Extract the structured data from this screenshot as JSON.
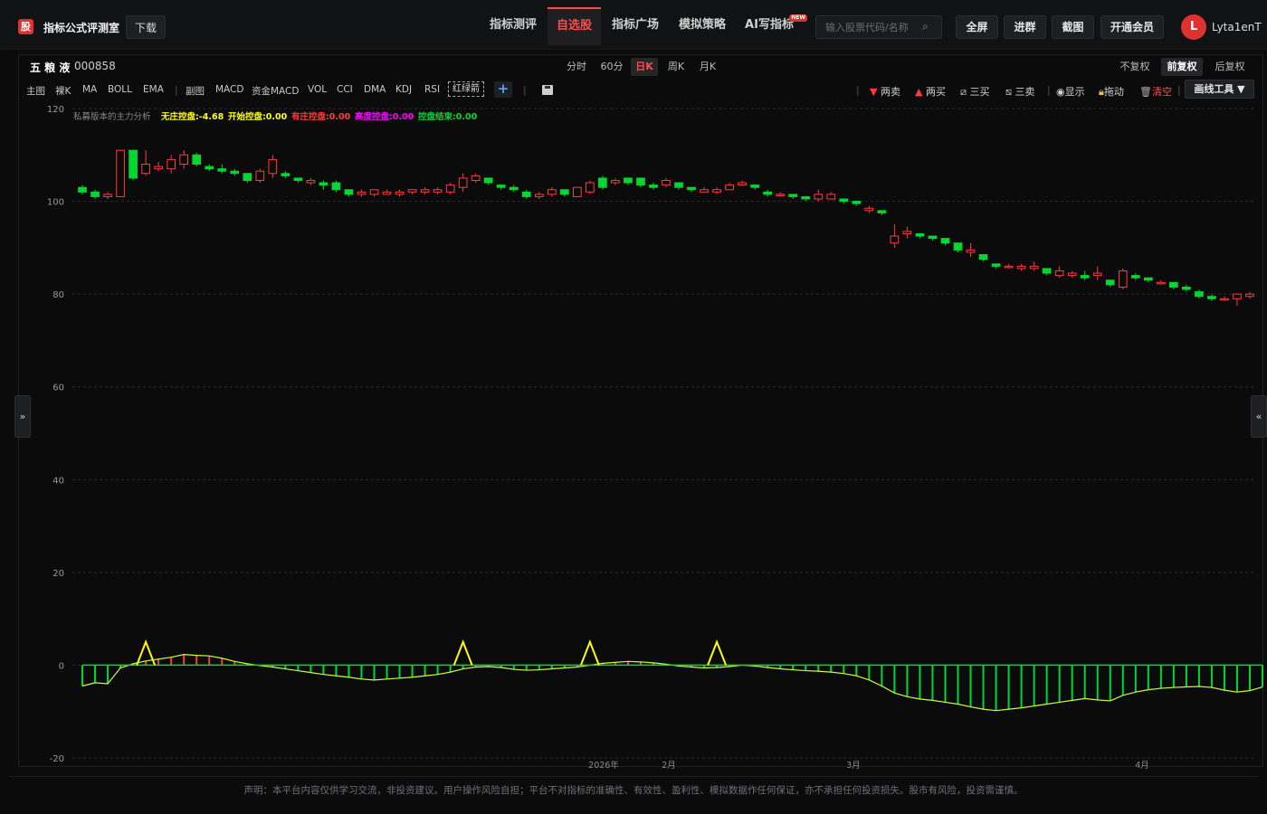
{
  "header": {
    "logo_char": "股",
    "title": "指标公式评测室",
    "download": "下载",
    "nav": [
      "指标测评",
      "自选股",
      "指标广场",
      "模拟策略",
      "AI写指标"
    ],
    "nav_active": 1,
    "new_badge": "NEW",
    "search_placeholder": "输入股票代码/名称",
    "buttons": [
      "全屏",
      "进群",
      "截图",
      "开通会员"
    ],
    "avatar_letter": "L",
    "username": "Lyta1enT"
  },
  "stock": {
    "name": "五 粮 液",
    "code": "000858"
  },
  "periods": [
    "分时",
    "60分",
    "日K",
    "周K",
    "月K"
  ],
  "period_active": 2,
  "fuquan": [
    "不复权",
    "前复权",
    "后复权"
  ],
  "fuquan_active": 1,
  "indicators_main": [
    "主图",
    "裸K",
    "MA",
    "BOLL",
    "EMA"
  ],
  "indicators_sub": [
    "副图",
    "MACD",
    "资金MACD",
    "VOL",
    "CCI",
    "DMA",
    "KDJ",
    "RSI"
  ],
  "indicator_boxed": "红绿箭",
  "tools": {
    "two_sell": "两卖",
    "two_buy": "两买",
    "three_buy": "三买",
    "three_sell": "三卖",
    "show": "显示",
    "drag": "拖动",
    "clear": "清空",
    "draw": "画线工具 ▼"
  },
  "colors": {
    "up": "#ff3b3b",
    "down": "#00d730",
    "accent": "#ff4b4b",
    "signal": "#ffff00",
    "magenta": "#ff00ff"
  },
  "legend": [
    {
      "label": "私募版本的主力分析",
      "color": "#888888"
    },
    {
      "label": "无庄控盘:-4.68",
      "color": "#ffff00"
    },
    {
      "label": "开始控盘:0.00",
      "color": "#ffff00"
    },
    {
      "label": "有庄控盘:0.00",
      "color": "#ff3b3b"
    },
    {
      "label": "高度控盘:0.00",
      "color": "#ff00ff"
    },
    {
      "label": "控盘结束:0.00",
      "color": "#00d730"
    }
  ],
  "chart_data": {
    "type": "candlestick",
    "y_ticks": [
      120,
      100,
      80,
      60,
      40,
      20,
      0,
      -20
    ],
    "ylim": [
      -20,
      120
    ],
    "x_labels": [
      "2026年",
      "2月",
      "3月",
      "4月"
    ],
    "grid": true,
    "candles": [
      [
        103,
        102,
        103.5,
        101.5
      ],
      [
        102,
        101,
        102.5,
        100.5
      ],
      [
        101,
        101.5,
        102,
        100.5
      ],
      [
        101,
        111,
        111,
        101
      ],
      [
        111,
        105,
        111,
        104.5
      ],
      [
        106,
        108,
        111,
        105.5
      ],
      [
        107,
        107.5,
        108.5,
        106.5
      ],
      [
        107,
        109,
        110,
        106
      ],
      [
        108,
        110,
        111,
        107
      ],
      [
        110,
        108,
        110.5,
        107.5
      ],
      [
        107.5,
        107,
        108,
        106.5
      ],
      [
        107,
        106.5,
        108,
        106
      ],
      [
        106.5,
        106,
        107,
        105.5
      ],
      [
        106,
        104.5,
        106,
        104
      ],
      [
        104.5,
        106.5,
        107,
        104
      ],
      [
        106,
        109,
        110,
        105
      ],
      [
        106,
        105.5,
        106.5,
        105
      ],
      [
        105,
        104.5,
        105,
        104
      ],
      [
        104,
        104.5,
        105,
        103.5
      ],
      [
        104,
        103.5,
        104.5,
        102.5
      ],
      [
        104,
        102.5,
        104.5,
        102
      ],
      [
        102.5,
        101.5,
        102.5,
        101
      ],
      [
        101.5,
        102,
        102.5,
        101
      ],
      [
        101.5,
        102.5,
        102.5,
        101
      ],
      [
        101.5,
        102,
        102.5,
        101.5
      ],
      [
        101.5,
        102,
        102.5,
        101
      ],
      [
        102,
        102.5,
        102.5,
        101.5
      ],
      [
        102,
        102.5,
        103,
        101.5
      ],
      [
        102,
        102.5,
        103,
        101.5
      ],
      [
        102,
        103.5,
        104,
        101.5
      ],
      [
        103,
        105,
        106,
        102
      ],
      [
        104.5,
        105.5,
        106,
        104
      ],
      [
        105,
        104,
        105,
        103.5
      ],
      [
        103.5,
        103,
        103.5,
        102.5
      ],
      [
        103,
        102.5,
        103.5,
        102
      ],
      [
        102,
        101,
        102.5,
        100.5
      ],
      [
        101,
        101.5,
        102,
        100.5
      ],
      [
        101.5,
        102.5,
        103,
        101
      ],
      [
        102.5,
        101.5,
        102.5,
        101
      ],
      [
        101,
        103,
        103,
        101
      ],
      [
        102,
        104,
        104.5,
        101.5
      ],
      [
        105,
        103,
        105.5,
        102.5
      ],
      [
        104,
        104.5,
        105,
        103.5
      ],
      [
        105,
        104,
        105,
        103.5
      ],
      [
        105,
        103.5,
        105,
        103
      ],
      [
        103.5,
        103,
        104,
        102.5
      ],
      [
        103.5,
        104.5,
        105,
        103
      ],
      [
        104,
        103,
        104,
        102.5
      ],
      [
        103,
        102.5,
        103,
        102
      ],
      [
        102,
        102.5,
        103,
        102
      ],
      [
        102,
        102.5,
        103,
        101.5
      ],
      [
        102.5,
        103.5,
        104,
        102.5
      ],
      [
        103.5,
        104,
        104.5,
        103.5
      ],
      [
        103.5,
        103,
        103.5,
        102.5
      ],
      [
        102,
        101.5,
        102.5,
        101
      ],
      [
        101.5,
        101.5,
        102,
        101
      ],
      [
        101.5,
        101,
        101.5,
        100.5
      ],
      [
        101,
        100.5,
        101,
        100
      ],
      [
        100.5,
        101.5,
        102.5,
        100
      ],
      [
        100.5,
        101.5,
        102,
        100.5
      ],
      [
        100.5,
        100,
        100.5,
        99.5
      ],
      [
        100,
        99.5,
        100,
        99
      ],
      [
        98,
        98.5,
        99,
        97.5
      ],
      [
        98,
        97.5,
        98,
        97
      ],
      [
        91,
        92.5,
        95,
        90
      ],
      [
        93,
        93.5,
        94.5,
        92
      ],
      [
        93,
        92.5,
        93,
        92
      ],
      [
        92.5,
        92,
        92.5,
        91.5
      ],
      [
        92,
        91,
        92,
        90.5
      ],
      [
        91,
        89.5,
        91,
        89
      ],
      [
        89,
        89.5,
        91,
        88
      ],
      [
        88.5,
        87.5,
        88.5,
        87
      ],
      [
        86.5,
        86,
        86.5,
        85.5
      ],
      [
        86,
        86,
        86.5,
        85.5
      ],
      [
        85.5,
        86,
        86.5,
        85
      ],
      [
        85.5,
        86,
        87,
        85
      ],
      [
        85.5,
        84.5,
        85.5,
        84
      ],
      [
        84,
        85,
        86,
        83.5
      ],
      [
        84,
        84.5,
        85,
        83.5
      ],
      [
        84,
        83.5,
        85,
        83
      ],
      [
        84,
        84.5,
        86,
        83
      ],
      [
        83,
        82,
        83,
        81.5
      ],
      [
        81.5,
        85,
        85.5,
        81
      ],
      [
        84,
        83.5,
        84.5,
        83
      ],
      [
        83.5,
        83,
        83.5,
        82.5
      ],
      [
        82.5,
        82.5,
        83,
        82
      ],
      [
        82.5,
        81.5,
        82.5,
        81
      ],
      [
        81.5,
        81,
        82,
        80.5
      ],
      [
        80.5,
        79.5,
        81,
        79
      ],
      [
        79.5,
        79,
        80,
        78.5
      ],
      [
        79,
        79,
        79.5,
        78.5
      ],
      [
        79,
        80,
        80,
        77.5
      ],
      [
        79.5,
        80,
        80.5,
        79
      ]
    ],
    "indicator": {
      "histogram": [
        -4.5,
        -3.8,
        -4,
        -0.6,
        0.3,
        0.9,
        1.3,
        1.7,
        2.3,
        2.1,
        2.0,
        1.5,
        0.8,
        0.3,
        -0.1,
        -0.4,
        -0.8,
        -1.2,
        -1.6,
        -2.0,
        -2.3,
        -2.6,
        -3.0,
        -3.2,
        -3.0,
        -2.8,
        -2.6,
        -2.3,
        -2.0,
        -1.5,
        -0.8,
        -0.4,
        -0.3,
        -0.5,
        -0.9,
        -1.1,
        -1.0,
        -0.8,
        -0.6,
        -0.4,
        0.0,
        0.4,
        0.6,
        0.8,
        0.7,
        0.5,
        0.2,
        -0.2,
        -0.4,
        -0.6,
        -0.5,
        -0.3,
        0.0,
        -0.2,
        -0.5,
        -0.8,
        -1.0,
        -1.2,
        -1.3,
        -1.5,
        -1.8,
        -2.3,
        -3.2,
        -4.5,
        -6.0,
        -6.8,
        -7.3,
        -7.6,
        -8.0,
        -8.4,
        -9.0,
        -9.5,
        -9.8,
        -9.5,
        -9.2,
        -8.8,
        -8.4,
        -8.0,
        -7.6,
        -7.2,
        -7.5,
        -7.7,
        -6.5,
        -5.8,
        -5.3,
        -5.0,
        -4.8,
        -4.7,
        -4.6,
        -4.8,
        -5.4,
        -5.8,
        -5.5,
        -4.7
      ],
      "triangles": [
        5,
        30,
        40,
        50
      ]
    }
  },
  "footer": "声明：本平台内容仅供学习交流，非投资建议。用户操作风险自担；平台不对指标的准确性、有效性、盈利性、模拟数据作任何保证，亦不承担任何投资损失。股市有风险，投资需谨慎。"
}
